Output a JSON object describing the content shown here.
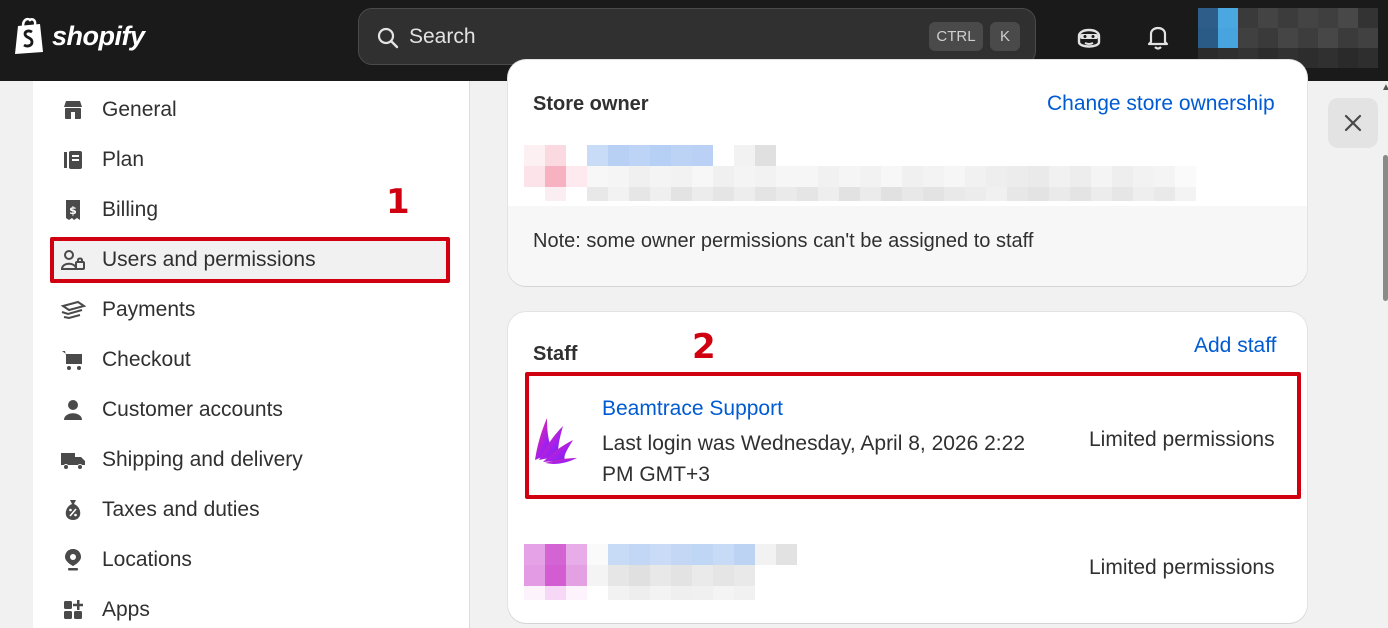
{
  "topbar": {
    "brand": "shopify",
    "search_placeholder": "Search",
    "shortcut_ctrl": "CTRL",
    "shortcut_k": "K"
  },
  "sidebar": {
    "items": [
      {
        "label": "General",
        "icon": "store-icon"
      },
      {
        "label": "Plan",
        "icon": "plan-icon"
      },
      {
        "label": "Billing",
        "icon": "receipt-icon"
      },
      {
        "label": "Users and permissions",
        "icon": "users-icon"
      },
      {
        "label": "Payments",
        "icon": "payments-icon"
      },
      {
        "label": "Checkout",
        "icon": "cart-icon"
      },
      {
        "label": "Customer accounts",
        "icon": "person-icon"
      },
      {
        "label": "Shipping and delivery",
        "icon": "truck-icon"
      },
      {
        "label": "Taxes and duties",
        "icon": "tax-icon"
      },
      {
        "label": "Locations",
        "icon": "location-icon"
      },
      {
        "label": "Apps",
        "icon": "apps-icon"
      }
    ]
  },
  "annotations": {
    "one": "1",
    "two": "2"
  },
  "store_owner": {
    "title": "Store owner",
    "action": "Change store ownership",
    "note": "Note: some owner permissions can't be assigned to staff"
  },
  "staff": {
    "title": "Staff",
    "action": "Add staff",
    "members": [
      {
        "name": "Beamtrace Support",
        "last_login": "Last login was Wednesday, April 8, 2026 2:22 PM GMT+3",
        "permissions": "Limited permissions"
      },
      {
        "name": "",
        "permissions": "Limited permissions"
      }
    ]
  },
  "colors": {
    "topbar": "#1a1a1a",
    "link": "#005bd3",
    "highlight": "#d10011"
  }
}
